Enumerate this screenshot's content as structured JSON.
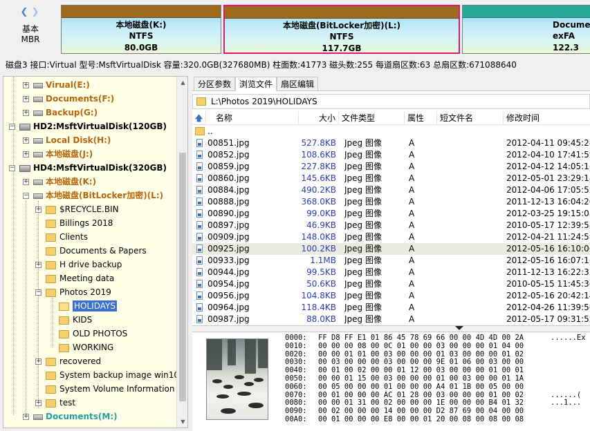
{
  "disk_map": {
    "disk_type": "基本",
    "disk_style": "MBR",
    "partitions": [
      {
        "name": "本地磁盘(K:)",
        "fs": "NTFS",
        "size": "80.0GB"
      },
      {
        "name": "本地磁盘(BitLocker加密)(L:)",
        "fs": "NTFS",
        "size": "117.7GB"
      },
      {
        "name": "Documer",
        "fs": "exFA",
        "size": "122.3"
      }
    ]
  },
  "disk_info": "磁盘3 接口:Virtual  型号:MsftVirtualDisk  容量:320.0GB(327680MB)  柱面数:41773  磁头数:255  每道扇区数:63  总扇区数:671088640",
  "tree": {
    "nodes": [
      {
        "label": "Virual(E:)",
        "kind": "vol"
      },
      {
        "label": "Documents(F:)",
        "kind": "vol"
      },
      {
        "label": "Backup(G:)",
        "kind": "vol"
      },
      {
        "label": "HD2:MsftVirtualDisk(120GB)",
        "kind": "hd"
      },
      {
        "label": "Local Disk(H:)",
        "kind": "vol"
      },
      {
        "label": "本地磁盘(J:)",
        "kind": "vol"
      },
      {
        "label": "HD4:MsftVirtualDisk(320GB)",
        "kind": "hd"
      },
      {
        "label": "本地磁盘(K:)",
        "kind": "vol"
      },
      {
        "label": "本地磁盘(BitLocker加密)(L:)",
        "kind": "vol"
      },
      {
        "label": "$RECYCLE.BIN",
        "kind": "folder"
      },
      {
        "label": "Billings 2018",
        "kind": "folder"
      },
      {
        "label": "Clients",
        "kind": "folder"
      },
      {
        "label": "Documents & Papers",
        "kind": "folder"
      },
      {
        "label": "H drive backup",
        "kind": "folder"
      },
      {
        "label": "Meeting data",
        "kind": "folder"
      },
      {
        "label": "Photos 2019",
        "kind": "folder"
      },
      {
        "label": "HOLIDAYS",
        "kind": "folder-selected"
      },
      {
        "label": "KIDS",
        "kind": "folder"
      },
      {
        "label": "OLD PHOTOS",
        "kind": "folder"
      },
      {
        "label": "WORKING",
        "kind": "folder"
      },
      {
        "label": "recovered",
        "kind": "folder"
      },
      {
        "label": "System backup image win10",
        "kind": "folder"
      },
      {
        "label": "System Volume Information",
        "kind": "folder"
      },
      {
        "label": "test",
        "kind": "folder"
      },
      {
        "label": "Documents(M:)",
        "kind": "vol-cyan"
      }
    ]
  },
  "tabs": [
    "分区参数",
    "浏览文件",
    "扇区编辑"
  ],
  "path": "L:\\Photos 2019\\HOLIDAYS",
  "file_columns": {
    "name": "名称",
    "size": "大小",
    "type": "文件类型",
    "attr": "属性",
    "short": "短文件名",
    "modified": "修改时间"
  },
  "files": [
    {
      "name": "..",
      "size": "",
      "type": "",
      "attr": "",
      "modified": "",
      "folder": true
    },
    {
      "name": "00851.jpg",
      "size": "527.8KB",
      "type": "Jpeg 图像",
      "attr": "A",
      "modified": "2012-04-11 09:45:24"
    },
    {
      "name": "00852.jpg",
      "size": "108.6KB",
      "type": "Jpeg 图像",
      "attr": "A",
      "modified": "2012-04-10 17:41:52"
    },
    {
      "name": "00859.jpg",
      "size": "227.8KB",
      "type": "Jpeg 图像",
      "attr": "A",
      "modified": "2012-04-12 14:05:16"
    },
    {
      "name": "00860.jpg",
      "size": "145.6KB",
      "type": "Jpeg 图像",
      "attr": "A",
      "modified": "2012-05-01 23:29:18"
    },
    {
      "name": "00884.jpg",
      "size": "490.2KB",
      "type": "Jpeg 图像",
      "attr": "A",
      "modified": "2012-04-06 17:05:52"
    },
    {
      "name": "00888.jpg",
      "size": "368.0KB",
      "type": "Jpeg 图像",
      "attr": "A",
      "modified": "2011-12-13 16:04:20"
    },
    {
      "name": "00890.jpg",
      "size": "99.0KB",
      "type": "Jpeg 图像",
      "attr": "A",
      "modified": "2012-03-25 19:15:08"
    },
    {
      "name": "00897.jpg",
      "size": "46.9KB",
      "type": "Jpeg 图像",
      "attr": "A",
      "modified": "2010-05-17 12:39:58"
    },
    {
      "name": "00909.jpg",
      "size": "148.0KB",
      "type": "Jpeg 图像",
      "attr": "A",
      "modified": "2012-04-21 11:24:58"
    },
    {
      "name": "00925.jpg",
      "size": "100.2KB",
      "type": "Jpeg 图像",
      "attr": "A",
      "modified": "2012-05-16 16:10:06",
      "selected": true
    },
    {
      "name": "00933.jpg",
      "size": "1.1MB",
      "type": "Jpeg 图像",
      "attr": "A",
      "modified": "2012-05-16 16:07:16"
    },
    {
      "name": "00944.jpg",
      "size": "99.5KB",
      "type": "Jpeg 图像",
      "attr": "A",
      "modified": "2011-12-13 16:22:32"
    },
    {
      "name": "00954.jpg",
      "size": "50.6KB",
      "type": "Jpeg 图像",
      "attr": "A",
      "modified": "2010-05-15 11:45:30"
    },
    {
      "name": "00956.jpg",
      "size": "104.8KB",
      "type": "Jpeg 图像",
      "attr": "A",
      "modified": "2012-05-16 20:42:14"
    },
    {
      "name": "00964.jpg",
      "size": "118.4KB",
      "type": "Jpeg 图像",
      "attr": "A",
      "modified": "2012-04-26 11:39:50"
    },
    {
      "name": "00987.jpg",
      "size": "88.0KB",
      "type": "Jpeg 图像",
      "attr": "A",
      "modified": "2012-05-17 09:31:52"
    }
  ],
  "hex": [
    {
      "off": "0000:",
      "bytes": "FF D8 FF E1 01 86 45 78 69 66 00 00 4D 4D 00 2A",
      "ascii": "......Ex"
    },
    {
      "off": "0010:",
      "bytes": "00 00 00 08 00 0C 01 00 00 03 00 00 00 01 04 00",
      "ascii": ""
    },
    {
      "off": "0020:",
      "bytes": "00 00 01 01 00 03 00 00 00 01 03 00 00 00 01 02",
      "ascii": ""
    },
    {
      "off": "0030:",
      "bytes": "00 03 00 00 00 03 00 00 00 9E 01 06 00 03 00 00",
      "ascii": ""
    },
    {
      "off": "0040:",
      "bytes": "00 01 00 02 00 00 01 12 00 03 00 00 00 01 00 01",
      "ascii": ""
    },
    {
      "off": "0050:",
      "bytes": "00 00 01 15 00 03 00 00 00 01 00 03 00 00 01 1A",
      "ascii": ""
    },
    {
      "off": "0060:",
      "bytes": "00 05 00 00 00 01 00 00 00 A4 01 1B 00 05 00 00",
      "ascii": ""
    },
    {
      "off": "0070:",
      "bytes": "00 01 00 00 00 AC 01 28 00 03 00 00 00 01 00 02",
      "ascii": "......("
    },
    {
      "off": "0080:",
      "bytes": "00 00 01 31 00 02 00 00 00 1E 00 00 00 B4 01 32",
      "ascii": "...1..."
    },
    {
      "off": "0090:",
      "bytes": "00 02 00 00 00 14 00 00 00 D2 87 69 00 04 00 00",
      "ascii": ""
    },
    {
      "off": "00A0:",
      "bytes": "00 01 00 00 00 E8 00 00 01 20 00 08 00 08 00 08",
      "ascii": ""
    }
  ]
}
